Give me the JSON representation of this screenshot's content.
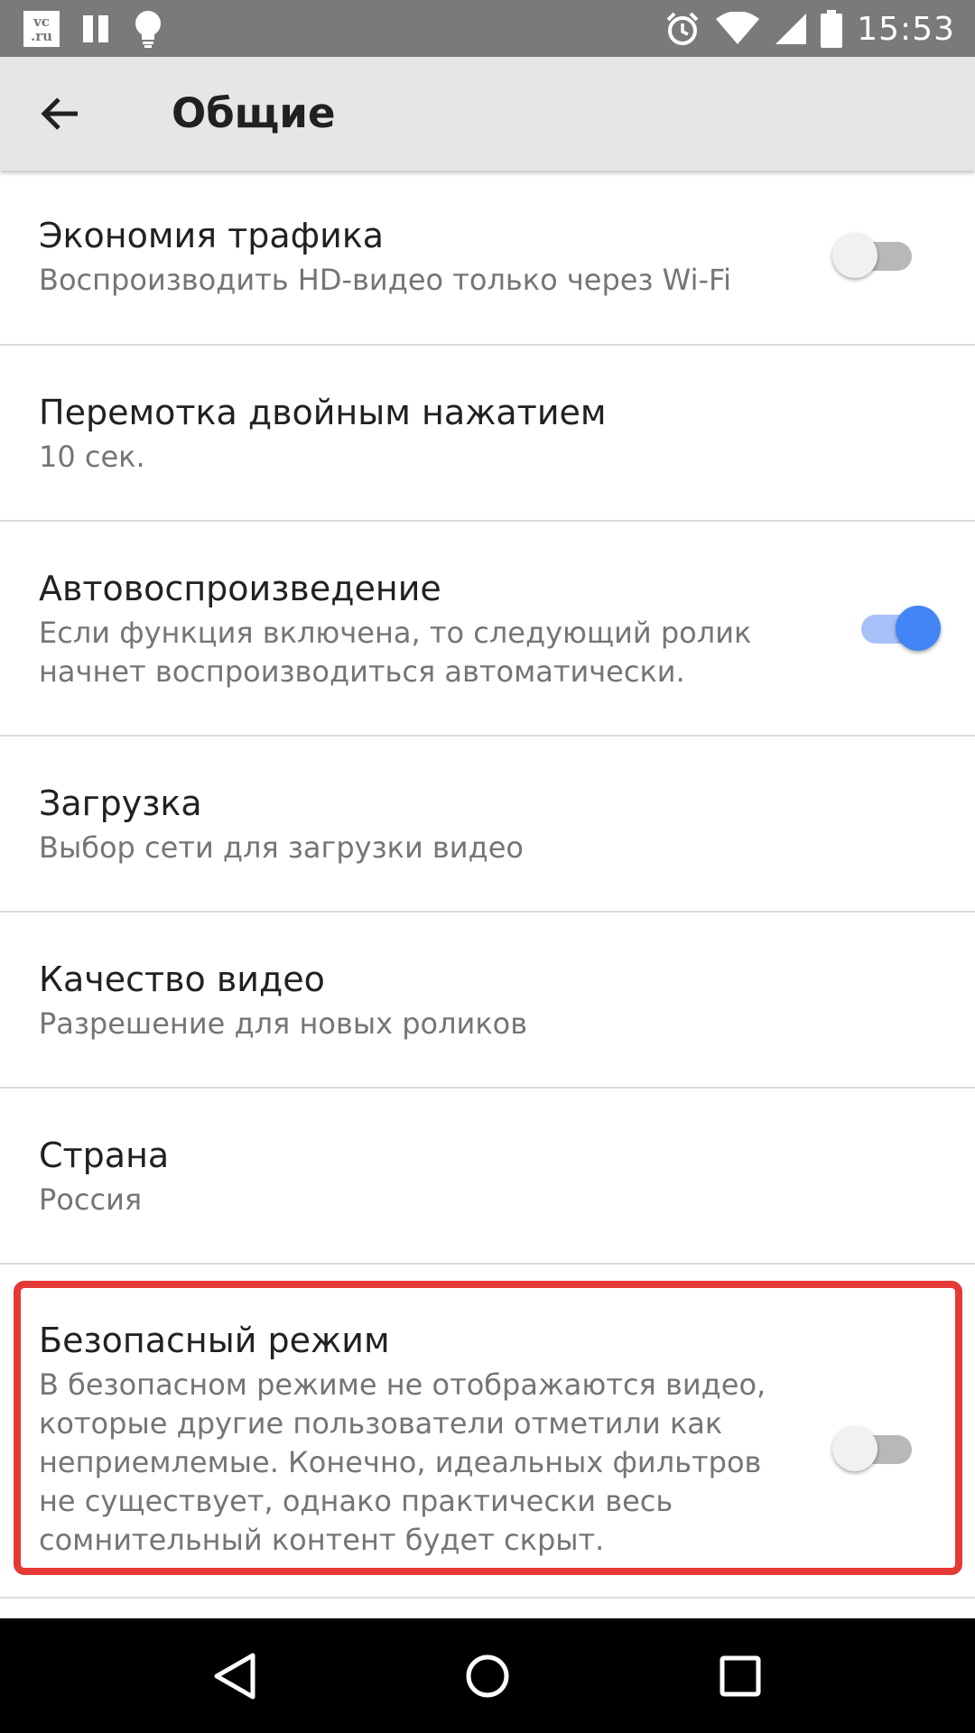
{
  "status_bar": {
    "logo_line1": "vc",
    "logo_line2": ".ru",
    "time": "15:53",
    "icons": [
      "vc-ru-logo-icon",
      "pause-icon",
      "lightbulb-icon",
      "alarm-icon",
      "wifi-icon",
      "signal-icon",
      "battery-icon"
    ]
  },
  "toolbar": {
    "back_icon": "arrow-back-icon",
    "title": "Общие"
  },
  "settings": [
    {
      "title": "Экономия трафика",
      "subtitle": "Воспроизводить HD-видео только через Wi-Fi",
      "switch": "off"
    },
    {
      "title": "Перемотка двойным нажатием",
      "subtitle": "10 сек."
    },
    {
      "title": "Автовоспроизведение",
      "subtitle": "Если функция включена, то следующий ролик начнет воспроизводиться автоматически.",
      "switch": "on"
    },
    {
      "title": "Загрузка",
      "subtitle": "Выбор сети для загрузки видео"
    },
    {
      "title": "Качество видео",
      "subtitle": "Разрешение для новых роликов"
    },
    {
      "title": "Страна",
      "subtitle": "Россия"
    },
    {
      "title": "Безопасный режим",
      "subtitle": "В безопасном режиме не отображаются видео, которые другие пользователи отметили как неприемлемые. Конечно, идеальных фильтров не существует, однако практически весь сомнительный контент будет скрыт.",
      "switch": "off"
    }
  ],
  "colors": {
    "status_bar": "#7a7a7a",
    "toolbar": "#e6e6e6",
    "switch_on": "#4285f4",
    "switch_on_track": "#a7c0f8",
    "highlight": "#e53935"
  },
  "nav_bar": {
    "icons": [
      "back-triangle-icon",
      "home-circle-icon",
      "recents-square-icon"
    ]
  }
}
